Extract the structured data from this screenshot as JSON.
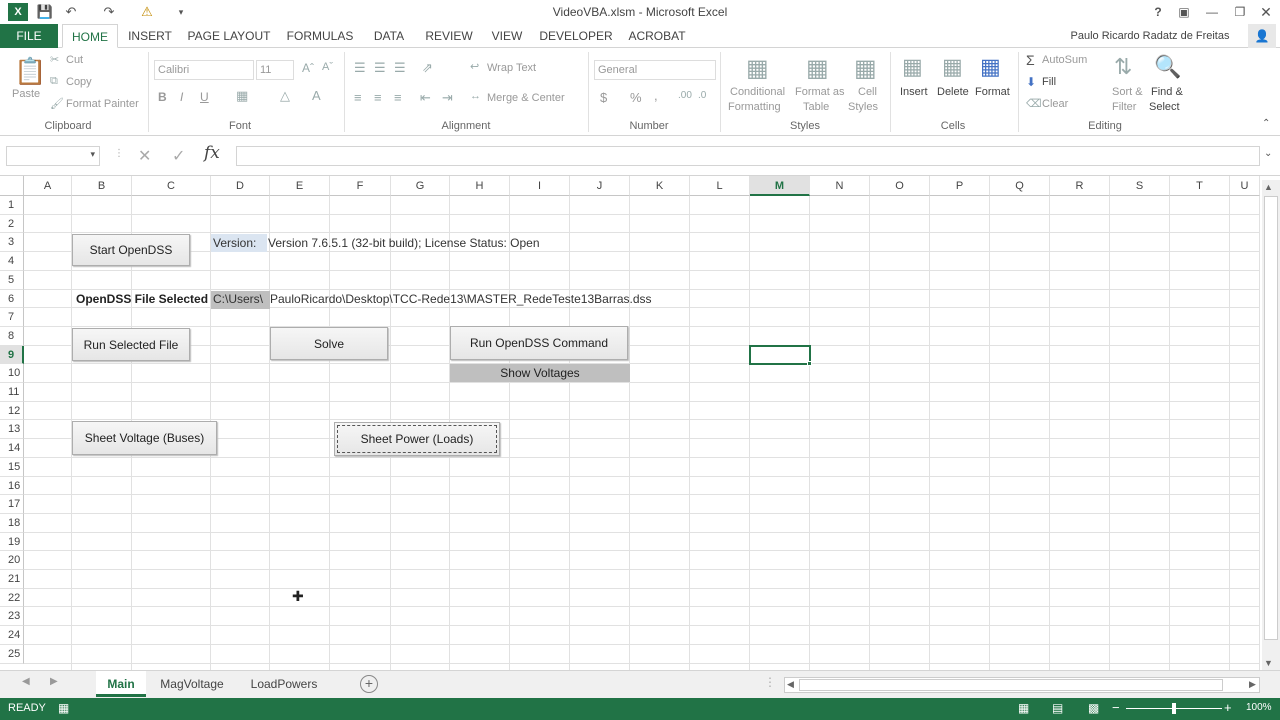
{
  "window": {
    "title": "VideoVBA.xlsm - Microsoft Excel",
    "user": "Paulo Ricardo Radatz de Freitas",
    "help": "?"
  },
  "tabs": [
    "FILE",
    "HOME",
    "INSERT",
    "PAGE LAYOUT",
    "FORMULAS",
    "DATA",
    "REVIEW",
    "VIEW",
    "DEVELOPER",
    "ACROBAT"
  ],
  "ribbon": {
    "clipboard": {
      "label": "Clipboard",
      "paste": "Paste",
      "cut": "Cut",
      "copy": "Copy",
      "format_painter": "Format Painter"
    },
    "font": {
      "label": "Font",
      "name": "Calibri",
      "size": "11",
      "bold": "B",
      "italic": "I",
      "underline": "U"
    },
    "alignment": {
      "label": "Alignment",
      "wrap_text": "Wrap Text",
      "merge_center": "Merge & Center"
    },
    "number": {
      "label": "Number",
      "format": "General",
      "currency": "$",
      "percent": "%",
      "comma": ","
    },
    "styles": {
      "label": "Styles",
      "conditional_1": "Conditional",
      "conditional_2": "Formatting",
      "format_table_1": "Format as",
      "format_table_2": "Table",
      "cell_styles_1": "Cell",
      "cell_styles_2": "Styles"
    },
    "cells": {
      "label": "Cells",
      "insert": "Insert",
      "delete": "Delete",
      "format": "Format"
    },
    "editing": {
      "label": "Editing",
      "autosum": "AutoSum",
      "fill": "Fill",
      "clear": "Clear",
      "sort_filter_1": "Sort &",
      "sort_filter_2": "Filter",
      "find_select_1": "Find &",
      "find_select_2": "Select"
    }
  },
  "formula_bar": {
    "fx": "fx",
    "value": ""
  },
  "columns": [
    "A",
    "B",
    "C",
    "D",
    "E",
    "F",
    "G",
    "H",
    "I",
    "J",
    "K",
    "L",
    "M",
    "N",
    "O",
    "P",
    "Q",
    "R",
    "S",
    "T",
    "U"
  ],
  "rows": [
    "1",
    "2",
    "3",
    "4",
    "5",
    "6",
    "7",
    "8",
    "9",
    "10",
    "11",
    "12",
    "13",
    "14",
    "15",
    "16",
    "17",
    "18",
    "19",
    "20",
    "21",
    "22",
    "23",
    "24",
    "25"
  ],
  "sheet": {
    "version_label": "Version:",
    "version_value": "Version 7.6.5.1 (32-bit build); License Status: Open",
    "file_label": "OpenDSS File Selected",
    "file_path_prefix": "C:\\Users\\",
    "file_path_rest": "PauloRicardo\\Desktop\\TCC-Rede13\\MASTER_RedeTeste13Barras.dss",
    "show_voltages": "Show Voltages"
  },
  "buttons": {
    "start": "Start OpenDSS",
    "run_selected": "Run Selected File",
    "solve": "Solve",
    "run_command": "Run OpenDSS Command",
    "sheet_voltage": "Sheet Voltage (Buses)",
    "sheet_power": "Sheet Power (Loads)"
  },
  "sheet_tabs": [
    "Main",
    "MagVoltage",
    "LoadPowers"
  ],
  "status": {
    "ready": "READY",
    "zoom": "100%"
  },
  "colors": {
    "accent": "#217346",
    "selection": "#217346"
  }
}
